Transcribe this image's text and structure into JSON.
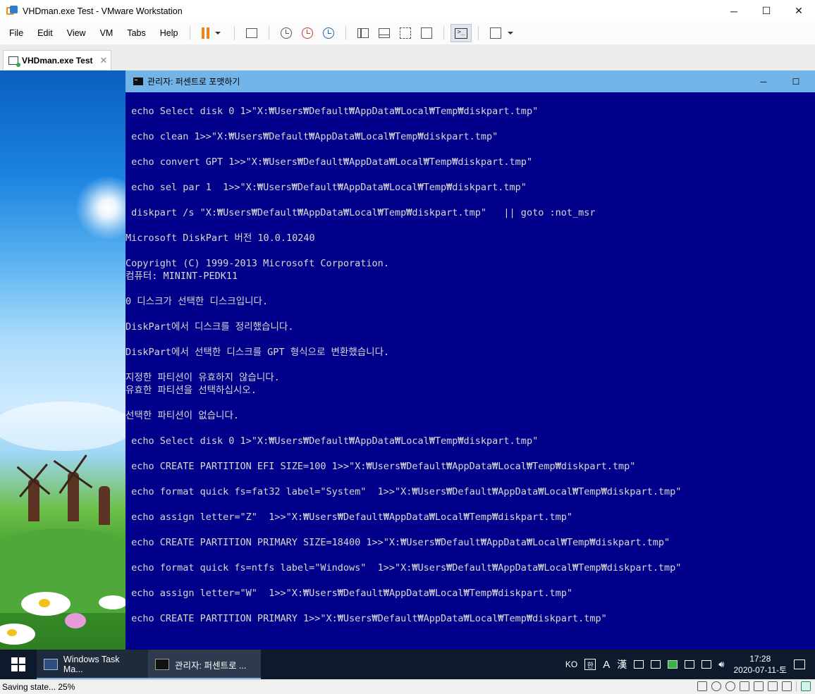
{
  "window": {
    "title": "VHDman.exe Test - VMware Workstation",
    "controls": {
      "minimize": "─",
      "maximize": "☐",
      "close": "✕"
    }
  },
  "menu": [
    "File",
    "Edit",
    "View",
    "VM",
    "Tabs",
    "Help"
  ],
  "tab": {
    "label": "VHDman.exe Test",
    "close": "✕"
  },
  "console": {
    "title": "관리자:  퍼센트로 포맷하기",
    "minimize": "─",
    "maximize": "☐",
    "lines": [
      " echo Select disk 0 1>\"X:₩Users₩Default₩AppData₩Local₩Temp₩diskpart.tmp\"",
      "",
      " echo clean 1>>\"X:₩Users₩Default₩AppData₩Local₩Temp₩diskpart.tmp\"",
      "",
      " echo convert GPT 1>>\"X:₩Users₩Default₩AppData₩Local₩Temp₩diskpart.tmp\"",
      "",
      " echo sel par 1  1>>\"X:₩Users₩Default₩AppData₩Local₩Temp₩diskpart.tmp\"",
      "",
      " diskpart /s \"X:₩Users₩Default₩AppData₩Local₩Temp₩diskpart.tmp\"   || goto :not_msr",
      "",
      "Microsoft DiskPart 버전 10.0.10240",
      "",
      "Copyright (C) 1999-2013 Microsoft Corporation.",
      "컴퓨터: MININT-PEDK11",
      "",
      "0 디스크가 선택한 디스크입니다.",
      "",
      "DiskPart에서 디스크를 정리했습니다.",
      "",
      "DiskPart에서 선택한 디스크를 GPT 형식으로 변환했습니다.",
      "",
      "지정한 파티션이 유효하지 않습니다.",
      "유효한 파티션을 선택하십시오.",
      "",
      "선택한 파티션이 없습니다.",
      "",
      " echo Select disk 0 1>\"X:₩Users₩Default₩AppData₩Local₩Temp₩diskpart.tmp\"",
      "",
      " echo CREATE PARTITION EFI SIZE=100 1>>\"X:₩Users₩Default₩AppData₩Local₩Temp₩diskpart.tmp\"",
      "",
      " echo format quick fs=fat32 label=\"System\"  1>>\"X:₩Users₩Default₩AppData₩Local₩Temp₩diskpart.tmp\"",
      "",
      " echo assign letter=\"Z\"  1>>\"X:₩Users₩Default₩AppData₩Local₩Temp₩diskpart.tmp\"",
      "",
      " echo CREATE PARTITION PRIMARY SIZE=18400 1>>\"X:₩Users₩Default₩AppData₩Local₩Temp₩diskpart.tmp\"",
      "",
      " echo format quick fs=ntfs label=\"Windows\"  1>>\"X:₩Users₩Default₩AppData₩Local₩Temp₩diskpart.tmp\"",
      "",
      " echo assign letter=\"W\"  1>>\"X:₩Users₩Default₩AppData₩Local₩Temp₩diskpart.tmp\"",
      "",
      " echo CREATE PARTITION PRIMARY 1>>\"X:₩Users₩Default₩AppData₩Local₩Temp₩diskpart.tmp\""
    ]
  },
  "taskbar": {
    "items": [
      {
        "label": "Windows Task Ma...",
        "icon": "task-manager-icon"
      },
      {
        "label": "관리자:  퍼센트로 ...",
        "icon": "cmd-icon"
      }
    ],
    "tray": {
      "lang": "KO",
      "ime1": "한",
      "ime2": "A",
      "ime3": "漢",
      "time": "17:28",
      "date": "2020-07-11-토"
    }
  },
  "status": {
    "text": "Saving state... 25%",
    "progress_percent": 25
  },
  "colors": {
    "console_bg": "#00008b",
    "console_title": "#73b4e8",
    "console_text": "#d8d8d8",
    "accent_orange": "#f0821e",
    "taskbar_bg": "#0e1a2c"
  }
}
